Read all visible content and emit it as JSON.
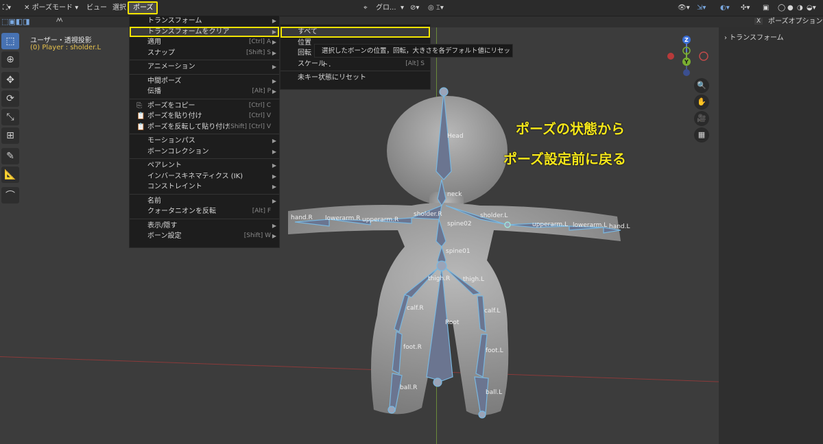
{
  "header": {
    "mode_label": "ポーズモード",
    "menus": [
      "ビュー",
      "選択",
      "ポーズ"
    ],
    "orientation_label": "グロ...",
    "right_panel_title": "ポーズオプション"
  },
  "viewport": {
    "title": "ユーザー・透視投影",
    "subtitle": "(0) Player : sholder.L"
  },
  "pose_menu": {
    "items": [
      {
        "label": "トランスフォーム",
        "shortcut": "",
        "arrow": true
      },
      {
        "label": "トランスフォームをクリア",
        "shortcut": "",
        "arrow": true,
        "highlighted": true
      },
      {
        "label": "適用",
        "shortcut": "[Ctrl] A",
        "arrow": true
      },
      {
        "label": "スナップ",
        "shortcut": "[Shift] S",
        "arrow": true
      },
      {
        "label": "アニメーション",
        "shortcut": "",
        "arrow": true
      },
      {
        "label": "中間ポーズ",
        "shortcut": "",
        "arrow": true
      },
      {
        "label": "伝播",
        "shortcut": "[Alt] P",
        "arrow": true
      },
      {
        "label": "ポーズをコピー",
        "shortcut": "[Ctrl] C",
        "arrow": false
      },
      {
        "label": "ポーズを貼り付け",
        "shortcut": "[Ctrl] V",
        "arrow": false
      },
      {
        "label": "ポーズを反転して貼り付け",
        "shortcut": "[Shift] [Ctrl] V",
        "arrow": false
      },
      {
        "label": "モーションパス",
        "shortcut": "",
        "arrow": true
      },
      {
        "label": "ボーンコレクション",
        "shortcut": "",
        "arrow": true
      },
      {
        "label": "ペアレント",
        "shortcut": "",
        "arrow": true
      },
      {
        "label": "インバースキネマティクス (IK)",
        "shortcut": "",
        "arrow": true
      },
      {
        "label": "コンストレイント",
        "shortcut": "",
        "arrow": true
      },
      {
        "label": "名前",
        "shortcut": "",
        "arrow": true
      },
      {
        "label": "クォータニオンを反転",
        "shortcut": "[Alt] F",
        "arrow": false
      },
      {
        "label": "表示/隠す",
        "shortcut": "",
        "arrow": true
      },
      {
        "label": "ボーン設定",
        "shortcut": "[Shift] W",
        "arrow": true
      }
    ]
  },
  "clear_submenu": {
    "items": [
      {
        "label": "すべて",
        "shortcut": "",
        "highlighted": true
      },
      {
        "label": "位置",
        "shortcut": ""
      },
      {
        "label": "回転",
        "shortcut": ""
      },
      {
        "label": "スケール",
        "shortcut": "[Alt] S"
      },
      {
        "label": "未キー状態にリセット",
        "shortcut": ""
      }
    ]
  },
  "tooltip": "選択したボーンの位置，回転，大きさを各デフォルト値にリセット．",
  "right_panel": {
    "section": "トランスフォーム"
  },
  "annotations": [
    "ポーズの状態から",
    "ポーズ設定前に戻る"
  ],
  "gizmo": {
    "z": "Z",
    "y": "Y"
  },
  "bones": [
    "Head",
    "neck",
    "sholder.R",
    "sholder.L",
    "spine02",
    "spine01",
    "hand.R",
    "lowerarm.R",
    "upperarm.R",
    "upperarm.L",
    "lowerarm.L",
    "hand.L",
    "thigh.R",
    "thigh.L",
    "calf.R",
    "calf.L",
    "Root",
    "foot.R",
    "foot.L",
    "ball.R",
    "ball.L"
  ],
  "colors": {
    "highlight": "#f2e400",
    "active_tool": "#4772b3",
    "bone_outline": "#7ab8e0"
  }
}
